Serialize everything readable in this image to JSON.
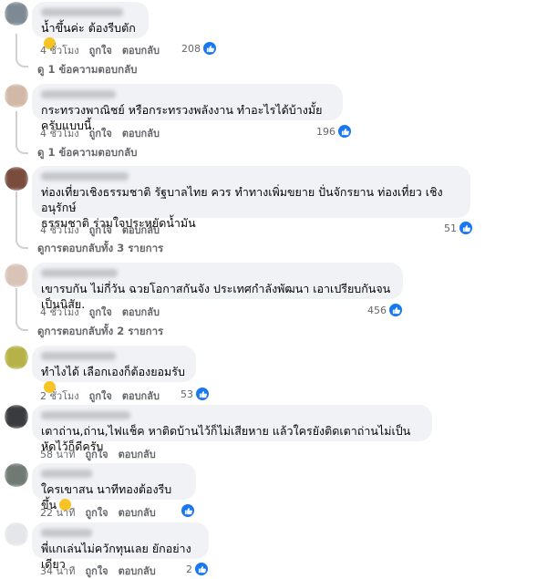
{
  "comments": [
    {
      "text": "น้ำขึ้นค่ะ ต้องรีบตัก",
      "emoji": "grinning-emoji",
      "time": "4 ชั่วโมง",
      "like": "ถูกใจ",
      "reply": "ตอบกลับ",
      "reactions": "208",
      "replies": "ดู 1 ข้อความตอบกลับ"
    },
    {
      "text": "กระทรวงพาณิชย์ หรือกระทรวงพลังงาน ทำอะไรได้บ้างมั้ยครับแบบนี้.",
      "time": "4 ชั่วโมง",
      "like": "ถูกใจ",
      "reply": "ตอบกลับ",
      "reactions": "196",
      "replies": "ดู 1 ข้อความตอบกลับ"
    },
    {
      "text": "ท่องเที่ยวเชิงธรรมชาติ รัฐบาลไทย ควร ทำทางเพิ่มขยาย ปั่นจักรยาน ท่องเที่ยว เชิงอนุรักษ์\nธรรมชาติ ร่วมใจประหยัดน้ำมัน",
      "time": "4 ชั่วโมง",
      "like": "ถูกใจ",
      "reply": "ตอบกลับ",
      "reactions": "51",
      "replies": "ดูการตอบกลับทั้ง 3 รายการ"
    },
    {
      "text": "เขารบกัน ไม่กี่วัน ฉวยโอกาสกันจัง ประเทศกำลังพัฒนา เอาเปรียบกันจนเป็นนิสัย.",
      "time": "4 ชั่วโมง",
      "like": "ถูกใจ",
      "reply": "ตอบกลับ",
      "reactions": "456",
      "replies": "ดูการตอบกลับทั้ง 2 รายการ"
    },
    {
      "text": "ทำไงได้ เลือกเองก็ต้องยอมรับ",
      "emoji": "laughing-emoji",
      "time": "2 ชั่วโมง",
      "like": "ถูกใจ",
      "reply": "ตอบกลับ",
      "reactions": "53"
    },
    {
      "text": "เตาถ่าน,ถ่าน,ไฟแช็ค หาติดบ้านไว้ก็ไม่เสียหาย แล้วใครยังติดเตาถ่านไม่เป็นหัดไว้ก็ดีครับ",
      "time": "58 นาที",
      "like": "ถูกใจ",
      "reply": "ตอบกลับ"
    },
    {
      "text": "ใครเขาสน นาทีทองต้องรีบขึ้น",
      "emoji": "grinning-emoji",
      "time": "22 นาที",
      "like": "ถูกใจ",
      "reply": "ตอบกลับ",
      "reactions": ""
    },
    {
      "text": "พี่แกเล่นไม่ควักทุนเลย ยักอย่างเดียว",
      "time": "34 นาที",
      "like": "ถูกใจ",
      "reply": "ตอบกลับ",
      "reactions": "2"
    }
  ],
  "colors": {
    "like": "#1877f2",
    "bubble": "#f0f2f5",
    "meta": "#65676b"
  }
}
